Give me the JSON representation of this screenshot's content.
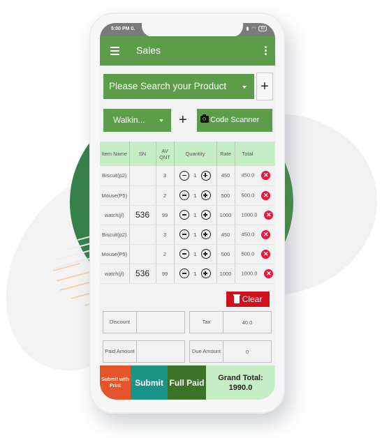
{
  "status_bar": {
    "time": "5:00 PM  0.",
    "battery": "60"
  },
  "app_bar": {
    "title": "Sales"
  },
  "product_search": {
    "placeholder": "Please Search your Product",
    "add_label": "+"
  },
  "customer": {
    "selected": "Walkin...",
    "add_label": "+"
  },
  "scanner": {
    "label": "Code Scanner"
  },
  "table": {
    "headers": [
      "Item Name",
      "SN",
      "AV QNT",
      "Quantity",
      "Rate",
      "Total"
    ],
    "rows": [
      {
        "item": "Biscuit(p2)",
        "sn": "",
        "av_qnt": "3",
        "qty": "1",
        "rate": "450",
        "total": "450.0"
      },
      {
        "item": "Mouse(P5)",
        "sn": "",
        "av_qnt": "2",
        "qty": "1",
        "rate": "500",
        "total": "500.0"
      },
      {
        "item": "watch(jl)",
        "sn": "536",
        "av_qnt": "99",
        "qty": "1",
        "rate": "1000",
        "total": "1000.0"
      },
      {
        "item": "Biscuit(p2)",
        "sn": "",
        "av_qnt": "3",
        "qty": "1",
        "rate": "450",
        "total": "450.0"
      },
      {
        "item": "Mouse(P5)",
        "sn": "",
        "av_qnt": "2",
        "qty": "1",
        "rate": "500",
        "total": "500.0"
      },
      {
        "item": "watch(jl)",
        "sn": "536",
        "av_qnt": "99",
        "qty": "1",
        "rate": "1000",
        "total": "1000.0"
      }
    ]
  },
  "clear_button": {
    "label": "Clear"
  },
  "summary": {
    "discount_label": "Discount",
    "discount_value": "",
    "tax_label": "Tax",
    "tax_value": "40.0",
    "paid_label": "Paid Amount",
    "paid_value": "",
    "due_label": "Due Amount",
    "due_value": "0"
  },
  "actions": {
    "submit_print": "Submit with Print",
    "submit": "Submit",
    "full_paid": "Full Paid",
    "grand_total_label": "Grand Total:",
    "grand_total_value": "1990.0"
  },
  "colors": {
    "primary": "#5b9d48",
    "header_bg": "#c6eec6",
    "danger": "#d0101c",
    "print": "#e5542a",
    "submit": "#199486",
    "full_paid": "#3c7329"
  }
}
